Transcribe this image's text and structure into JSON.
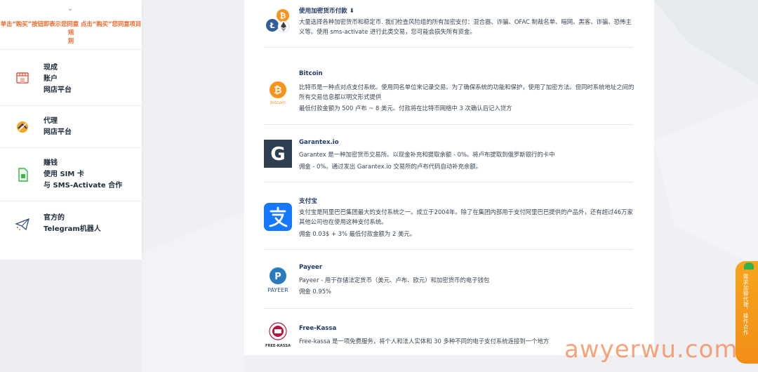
{
  "sidebar": {
    "notice_part1": "单击“购买”按钮即表示您同意",
    "notice_part2": "点击“购买”您同意项目规",
    "notice_part3": "则",
    "items": [
      {
        "icon": "shop-icon",
        "line1": "现成",
        "line2": "账户",
        "line3": "网店平台"
      },
      {
        "icon": "partner-icon",
        "line1": "代理",
        "line2": "网店平台"
      },
      {
        "icon": "sim-card-icon",
        "line1": "赚钱",
        "line2": "使用 SIM 卡",
        "line3": "与 SMS-Activate 合作"
      },
      {
        "icon": "telegram-icon",
        "line1": "官方的",
        "line2": "Telegram机器人"
      }
    ]
  },
  "payments": {
    "crypto": {
      "title": "使用加密货币付款 ⬇",
      "desc": "大量选择各种加密货币和稳定币. 我们检查风险组的所有加密支付：混合器、诈骗、OFAC 制裁名单、暗网、黑客、诈骗、恐怖主义等。使用 sms-activate 进行此类交易，您可能会损失所有资金。"
    },
    "bitcoin": {
      "title": "Bitcoin",
      "logo_text": "bitcoin",
      "desc": "比特币是一种点对点支付系统。使用同名单位来记录交易。为了确保系统的功能和保护，使用了加密方法。但同时系统地址之间的所有交易信息都以明文形式提供",
      "desc2": "最低付款金额为 500 卢布 ~ 8 美元。付款将在比特币网络中 3 次确认后记入贷方"
    },
    "garantex": {
      "title": "Garantex.io",
      "desc": "Garantex 是一种加密货币交易所。以现金补充和提取余额 - 0%。将卢布提取到俄罗斯银行的卡中",
      "desc2": "佣金 - 0%。通过发出 Garantex.io 交易所的卢布代码自动补充余额。"
    },
    "alipay": {
      "title": "支付宝",
      "desc": "支付宝是阿里巴巴集团最大的支付系统之一。成立于2004年。除了在集团内部用于支付阿里巴巴提供的产品外，还有超过46万家其他公司也在使用这种支付系统。",
      "desc2": "佣金 0.03$ + 3% 最低付款金额为 2 美元。"
    },
    "payeer": {
      "title": "Payeer",
      "logo_text": "PAYEER",
      "desc": "Payeer - 用于存储法定货币（美元、卢布、欧元）和加密货币的电子钱包",
      "desc2": "佣金 0.95%"
    },
    "freekassa": {
      "title": "Free-Kassa",
      "logo_text": "FREE-KASSA",
      "desc": "Free-kassa 是一项免费服务，将个人和法人实体和 30 多种不同的电子支付系统连接到一个地方"
    }
  },
  "side_widget": {
    "text": "需求加盟代理，操作合作"
  },
  "watermark": "awyerwu.com",
  "colors": {
    "accent_orange": "#f0692b",
    "bitcoin_orange": "#f7931a",
    "alipay_blue": "#1677ff",
    "garantex_dark": "#2f3f52",
    "payeer_blue": "#2a7ac0",
    "freekassa_red": "#b3143b"
  }
}
